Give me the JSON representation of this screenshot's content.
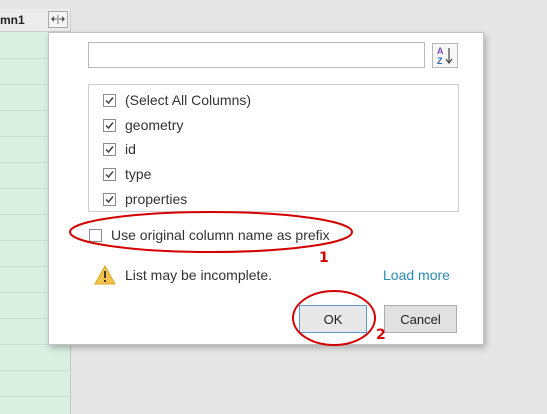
{
  "grid": {
    "column_header": "mn1"
  },
  "dialog": {
    "search": {
      "value": "",
      "placeholder": ""
    },
    "sort_icon": "sort-ascending-icon",
    "columns": [
      {
        "label": "(Select All Columns)",
        "checked": true
      },
      {
        "label": "geometry",
        "checked": true
      },
      {
        "label": "id",
        "checked": true
      },
      {
        "label": "type",
        "checked": true
      },
      {
        "label": "properties",
        "checked": true
      }
    ],
    "prefix_option": {
      "label": "Use original column name as prefix",
      "checked": false
    },
    "warning": {
      "text": "List may be incomplete.",
      "icon": "warning-icon"
    },
    "load_more": "Load more",
    "ok_label": "OK",
    "cancel_label": "Cancel"
  },
  "annotations": {
    "label_1": "1",
    "label_2": "2",
    "color": "#d40000"
  },
  "colors": {
    "grid_cell": "#d8efe1",
    "link": "#2b8ab0",
    "ok_border": "#5b9bd5"
  }
}
